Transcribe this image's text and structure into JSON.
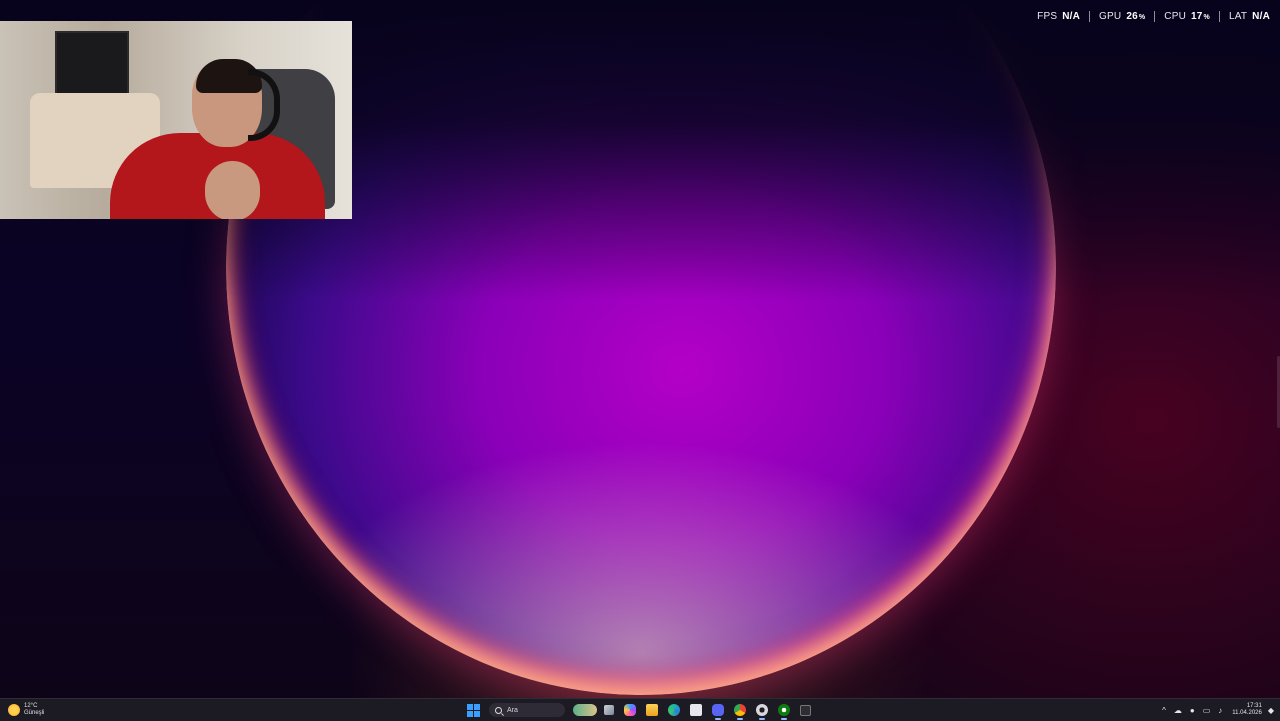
{
  "overlay": {
    "stats": [
      {
        "label": "FPS",
        "value": "N/A",
        "unit": ""
      },
      {
        "label": "GPU",
        "value": "26",
        "unit": "%"
      },
      {
        "label": "CPU",
        "value": "17",
        "unit": "%"
      },
      {
        "label": "LAT",
        "value": "N/A",
        "unit": ""
      }
    ]
  },
  "taskbar": {
    "weather": {
      "temp": "12°C",
      "condition": "Güneşli"
    },
    "search_placeholder": "Ara",
    "icons": [
      "windows-start-icon",
      "search-icon",
      "widgets-icon",
      "task-view-icon",
      "copilot-icon",
      "file-explorer-icon",
      "edge-icon",
      "store-icon",
      "discord-icon",
      "chrome-icon",
      "settings-icon",
      "xbox-icon",
      "obs-icon"
    ],
    "tray": {
      "time": "17:31",
      "date": "11.04.2026"
    }
  },
  "colors": {
    "accent": "#3aa0ff",
    "taskbar_bg": "#1c1a22"
  }
}
